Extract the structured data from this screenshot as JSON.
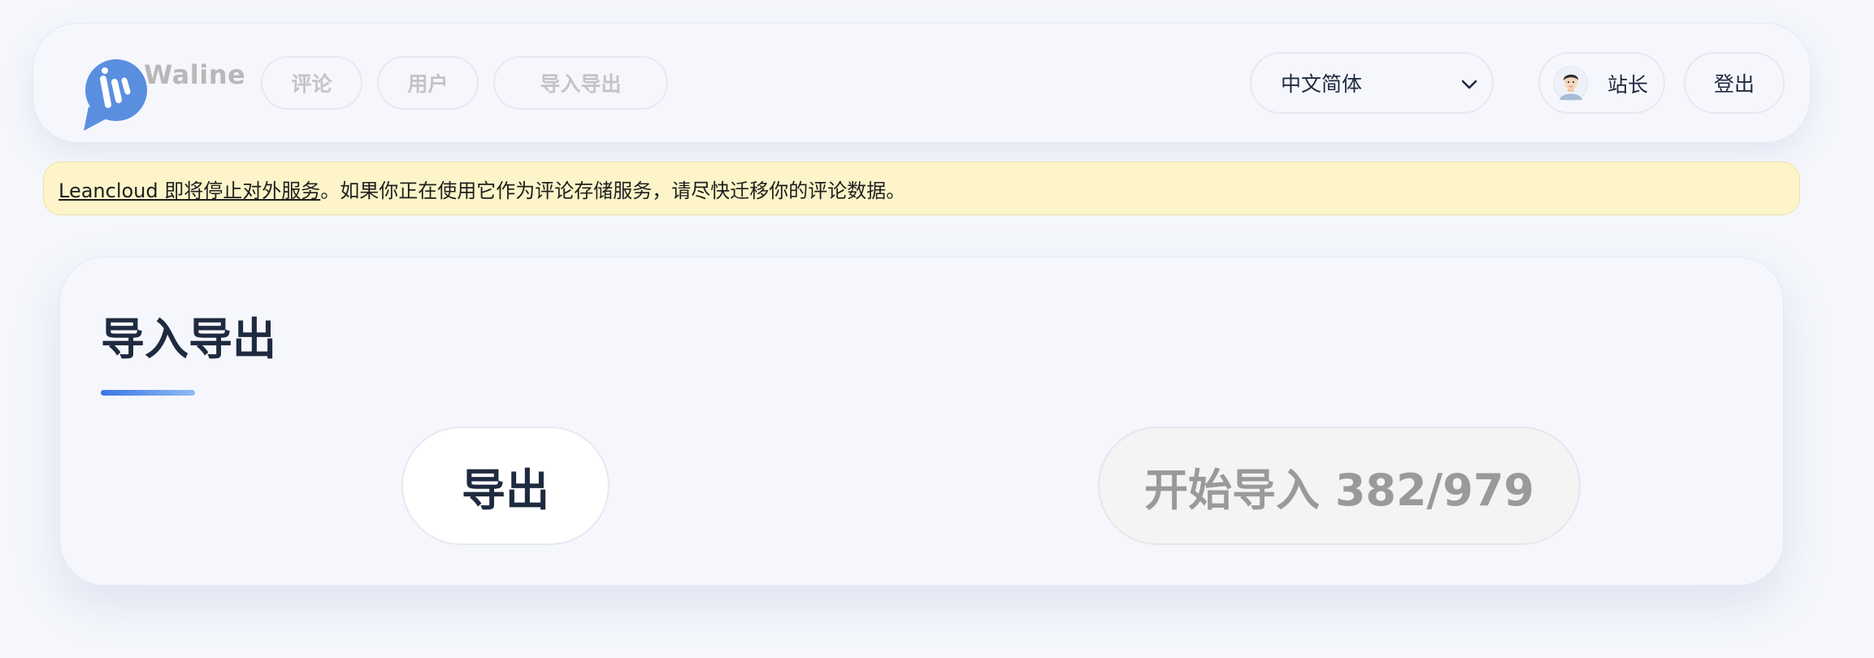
{
  "brand": {
    "name": "Waline",
    "logo_icon": "waline-logo-icon",
    "logo_color": "#5a8fe0"
  },
  "nav": {
    "items": [
      {
        "label": "评论"
      },
      {
        "label": "用户"
      },
      {
        "label": "导入导出"
      }
    ]
  },
  "language": {
    "selected": "中文简体"
  },
  "user": {
    "name": "站长",
    "avatar_icon": "avatar-icon"
  },
  "logout": {
    "label": "登出"
  },
  "notice": {
    "link_text": "Leancloud 即将停止对外服务",
    "message": "。如果你正在使用它作为评论存储服务，请尽快迁移你的评论数据。",
    "background": "#fdf5c9"
  },
  "main": {
    "title": "导入导出",
    "export_label": "导出",
    "import_label": "开始导入 382/979"
  },
  "colors": {
    "accent": "#3b74e6",
    "text": "#1e2a3f",
    "muted": "#c4c4c4"
  }
}
